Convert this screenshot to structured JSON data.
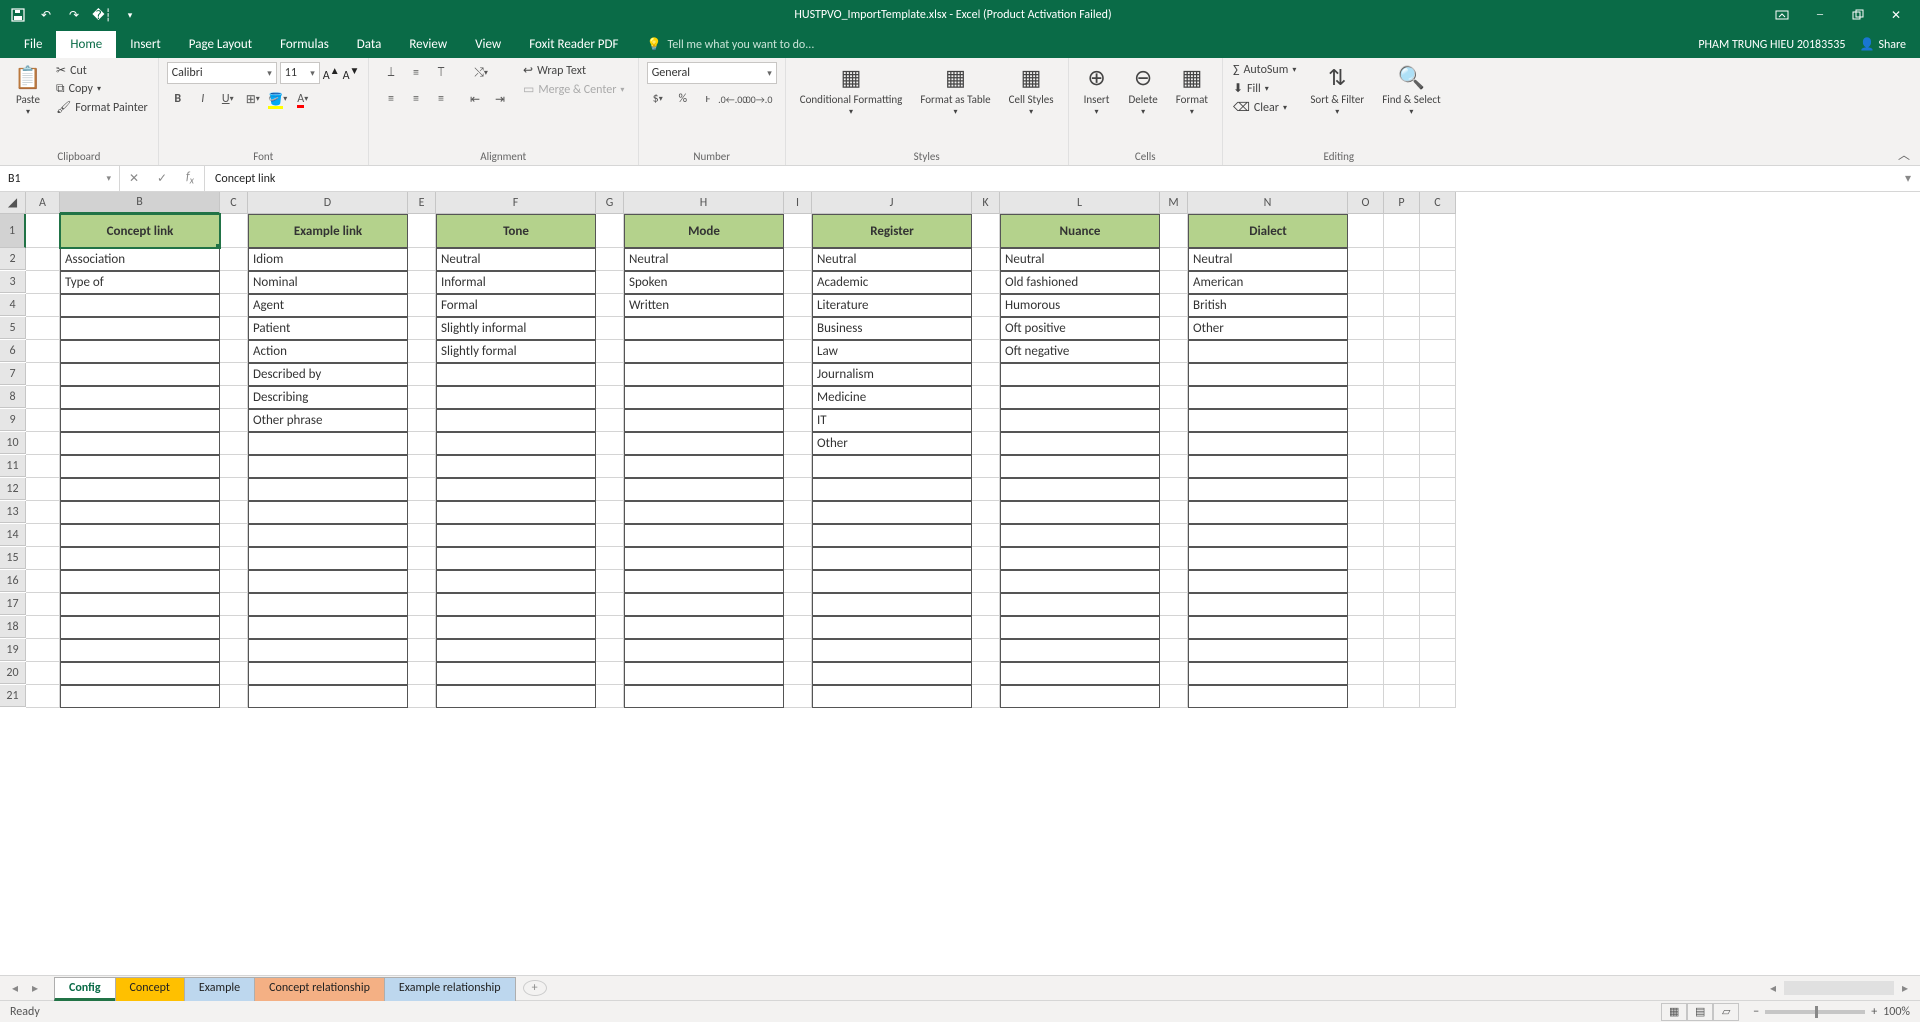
{
  "title": "HUSTPVO_ImportTemplate.xlsx - Excel (Product Activation Failed)",
  "user": "PHAM TRUNG HIEU 20183535",
  "share_label": "Share",
  "tabs": {
    "file": "File",
    "home": "Home",
    "insert": "Insert",
    "page": "Page Layout",
    "formulas": "Formulas",
    "data": "Data",
    "review": "Review",
    "view": "View",
    "foxit": "Foxit Reader PDF"
  },
  "tell_me": "Tell me what you want to do...",
  "clipboard": {
    "paste": "Paste",
    "cut": "Cut",
    "copy": "Copy",
    "fp": "Format Painter",
    "label": "Clipboard"
  },
  "font": {
    "name": "Calibri",
    "size": "11",
    "label": "Font"
  },
  "alignment": {
    "wrap": "Wrap Text",
    "merge": "Merge & Center",
    "label": "Alignment"
  },
  "number": {
    "format": "General",
    "label": "Number"
  },
  "styles": {
    "cond": "Conditional Formatting",
    "fat": "Format as Table",
    "cell": "Cell Styles",
    "label": "Styles"
  },
  "cells": {
    "insert": "Insert",
    "delete": "Delete",
    "format": "Format",
    "label": "Cells"
  },
  "editing": {
    "autosum": "AutoSum",
    "fill": "Fill",
    "clear": "Clear",
    "sort": "Sort & Filter",
    "find": "Find & Select",
    "label": "Editing"
  },
  "name_box": "B1",
  "formula_value": "Concept link",
  "headers": [
    "Concept link",
    "Example link",
    "Tone",
    "Mode",
    "Register",
    "Nuance",
    "Dialect"
  ],
  "columns": {
    "concept_link": [
      "Association",
      "Type of"
    ],
    "example_link": [
      "Idiom",
      "Nominal",
      "Agent",
      "Patient",
      "Action",
      "Described by",
      "Describing",
      "Other phrase"
    ],
    "tone": [
      "Neutral",
      "Informal",
      "Formal",
      "Slightly informal",
      "Slightly formal"
    ],
    "mode": [
      "Neutral",
      "Spoken",
      "Written"
    ],
    "register": [
      "Neutral",
      "Academic",
      "Literature",
      "Business",
      "Law",
      "Journalism",
      "Medicine",
      "IT",
      "Other"
    ],
    "nuance": [
      "Neutral",
      "Old fashioned",
      "Humorous",
      "Oft positive",
      "Oft negative"
    ],
    "dialect": [
      "Neutral",
      "American",
      "British",
      "Other"
    ]
  },
  "col_letters": [
    "A",
    "B",
    "C",
    "D",
    "E",
    "F",
    "G",
    "H",
    "I",
    "J",
    "K",
    "L",
    "M",
    "N",
    "O",
    "P",
    "C"
  ],
  "row_count": 21,
  "sheet_tabs": [
    {
      "name": "Config",
      "cls": "active"
    },
    {
      "name": "Concept",
      "cls": "yellow"
    },
    {
      "name": "Example",
      "cls": "blue"
    },
    {
      "name": "Concept relationship",
      "cls": "orange"
    },
    {
      "name": "Example relationship",
      "cls": "blue"
    }
  ],
  "status": "Ready",
  "zoom": "100%"
}
